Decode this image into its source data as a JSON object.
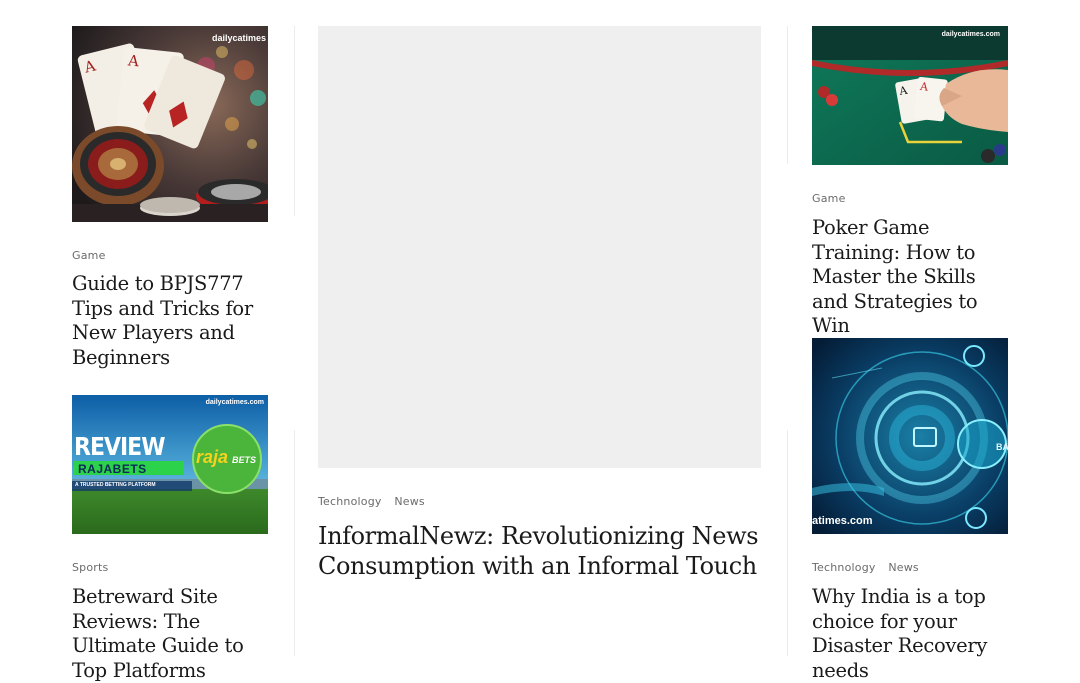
{
  "left_column": {
    "post1": {
      "category": "Game",
      "title": "Guide to BPJS777 Tips and Tricks for New Players and Beginners",
      "image_watermark": "dailycatimes"
    },
    "post2": {
      "category": "Sports",
      "title": "Betreward Site Reviews: The Ultimate Guide to Top Platforms",
      "image_watermark": "dailycatimes.com",
      "image_text": {
        "review": "REVIEW",
        "brand": "RAJABETS",
        "tagline": "A TRUSTED BETTING PLATFORM",
        "logo_main": "raja",
        "logo_sub": "BETS"
      }
    }
  },
  "center_column": {
    "featured": {
      "categories": [
        "Technology",
        "News"
      ],
      "title": "InformalNewz: Revolutionizing News Consumption with an Informal Touch"
    }
  },
  "right_column": {
    "post1": {
      "category": "Game",
      "title": "Poker Game Training: How to Master the Skills and Strategies to Win",
      "image_watermark": "dailycatimes.com"
    },
    "post2": {
      "categories": [
        "Technology",
        "News"
      ],
      "title": "Why India is a top choice for your Disaster Recovery needs",
      "image_watermark": "atimes.com",
      "image_text": {
        "back": "BACK"
      }
    }
  }
}
